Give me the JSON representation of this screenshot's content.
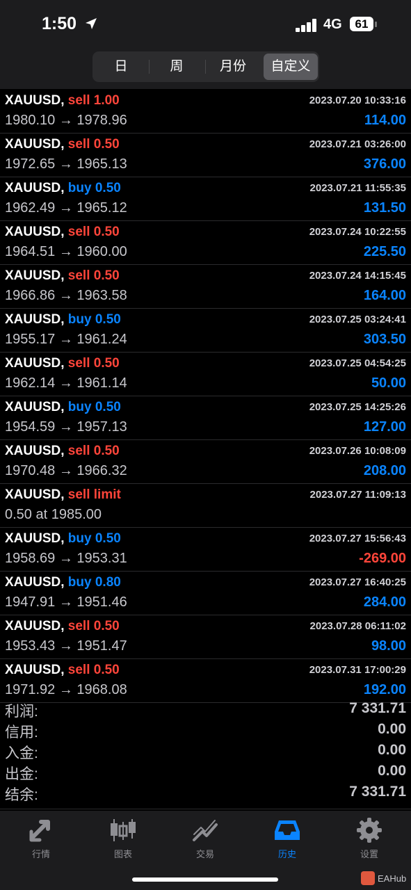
{
  "status": {
    "time": "1:50",
    "network": "4G",
    "battery": "61"
  },
  "period_tabs": [
    {
      "label": "日",
      "active": false
    },
    {
      "label": "周",
      "active": false
    },
    {
      "label": "月份",
      "active": false
    },
    {
      "label": "自定义",
      "active": true
    }
  ],
  "trades": [
    {
      "symbol": "XAUUSD,",
      "side": "sell",
      "action": "sell 1.00",
      "time": "2023.07.20 10:33:16",
      "prices": "1980.10 → 1978.96",
      "profit": "114.00",
      "profit_sign": "pos"
    },
    {
      "symbol": "XAUUSD,",
      "side": "sell",
      "action": "sell 0.50",
      "time": "2023.07.21 03:26:00",
      "prices": "1972.65 → 1965.13",
      "profit": "376.00",
      "profit_sign": "pos"
    },
    {
      "symbol": "XAUUSD,",
      "side": "buy",
      "action": "buy 0.50",
      "time": "2023.07.21 11:55:35",
      "prices": "1962.49 → 1965.12",
      "profit": "131.50",
      "profit_sign": "pos"
    },
    {
      "symbol": "XAUUSD,",
      "side": "sell",
      "action": "sell 0.50",
      "time": "2023.07.24 10:22:55",
      "prices": "1964.51 → 1960.00",
      "profit": "225.50",
      "profit_sign": "pos"
    },
    {
      "symbol": "XAUUSD,",
      "side": "sell",
      "action": "sell 0.50",
      "time": "2023.07.24 14:15:45",
      "prices": "1966.86 → 1963.58",
      "profit": "164.00",
      "profit_sign": "pos"
    },
    {
      "symbol": "XAUUSD,",
      "side": "buy",
      "action": "buy 0.50",
      "time": "2023.07.25 03:24:41",
      "prices": "1955.17 → 1961.24",
      "profit": "303.50",
      "profit_sign": "pos"
    },
    {
      "symbol": "XAUUSD,",
      "side": "sell",
      "action": "sell 0.50",
      "time": "2023.07.25 04:54:25",
      "prices": "1962.14 → 1961.14",
      "profit": "50.00",
      "profit_sign": "pos"
    },
    {
      "symbol": "XAUUSD,",
      "side": "buy",
      "action": "buy 0.50",
      "time": "2023.07.25 14:25:26",
      "prices": "1954.59 → 1957.13",
      "profit": "127.00",
      "profit_sign": "pos"
    },
    {
      "symbol": "XAUUSD,",
      "side": "sell",
      "action": "sell 0.50",
      "time": "2023.07.26 10:08:09",
      "prices": "1970.48 → 1966.32",
      "profit": "208.00",
      "profit_sign": "pos"
    },
    {
      "symbol": "XAUUSD,",
      "side": "sell",
      "action": "sell limit",
      "time": "2023.07.27 11:09:13",
      "prices": "0.50 at 1985.00",
      "profit": "",
      "profit_sign": "pos"
    },
    {
      "symbol": "XAUUSD,",
      "side": "buy",
      "action": "buy 0.50",
      "time": "2023.07.27 15:56:43",
      "prices": "1958.69 → 1953.31",
      "profit": "-269.00",
      "profit_sign": "neg"
    },
    {
      "symbol": "XAUUSD,",
      "side": "buy",
      "action": "buy 0.80",
      "time": "2023.07.27 16:40:25",
      "prices": "1947.91 → 1951.46",
      "profit": "284.00",
      "profit_sign": "pos"
    },
    {
      "symbol": "XAUUSD,",
      "side": "sell",
      "action": "sell 0.50",
      "time": "2023.07.28 06:11:02",
      "prices": "1953.43 → 1951.47",
      "profit": "98.00",
      "profit_sign": "pos"
    },
    {
      "symbol": "XAUUSD,",
      "side": "sell",
      "action": "sell 0.50",
      "time": "2023.07.31 17:00:29",
      "prices": "1971.92 → 1968.08",
      "profit": "192.00",
      "profit_sign": "pos"
    }
  ],
  "summary": [
    {
      "label": "利润:",
      "value": "7 331.71"
    },
    {
      "label": "信用:",
      "value": "0.00"
    },
    {
      "label": "入金:",
      "value": "0.00"
    },
    {
      "label": "出金:",
      "value": "0.00"
    },
    {
      "label": "结余:",
      "value": "7 331.71"
    }
  ],
  "tabbar": [
    {
      "label": "行情",
      "icon": "quotes-arrows-icon",
      "active": false
    },
    {
      "label": "图表",
      "icon": "candlestick-chart-icon",
      "active": false
    },
    {
      "label": "交易",
      "icon": "trade-line-icon",
      "active": false
    },
    {
      "label": "历史",
      "icon": "history-inbox-icon",
      "active": true
    },
    {
      "label": "设置",
      "icon": "gear-icon",
      "active": false
    }
  ],
  "watermark": "EAHub",
  "colors": {
    "sell": "#ff453a",
    "buy": "#0a84ff",
    "background": "#000000"
  }
}
